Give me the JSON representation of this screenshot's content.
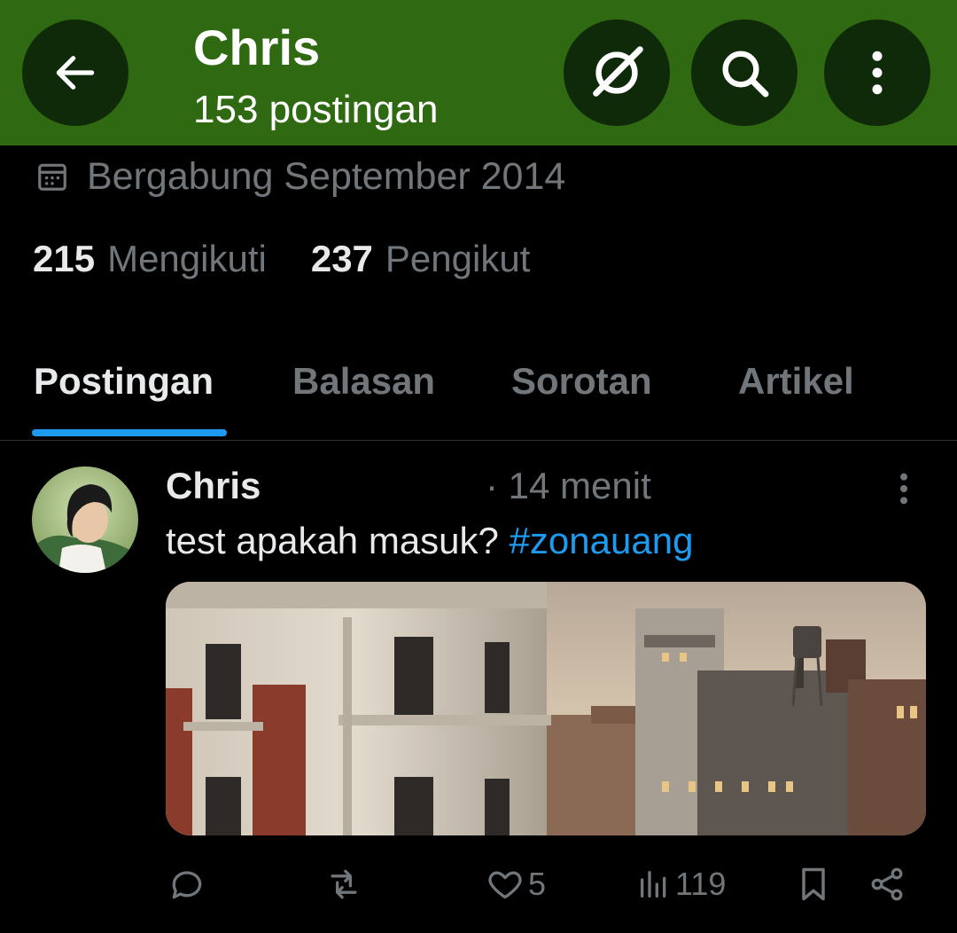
{
  "header": {
    "name": "Chris",
    "post_count": "153 postingan",
    "back_icon": "arrow-left-icon",
    "grok_icon": "grok-icon",
    "search_icon": "search-icon",
    "more_icon": "more-vertical-icon",
    "bg_color": "#2f6a12"
  },
  "profile": {
    "joined": "Bergabung September 2014",
    "following_count": "215",
    "following_label": "Mengikuti",
    "followers_count": "237",
    "followers_label": "Pengikut"
  },
  "tabs": [
    {
      "label": "Postingan",
      "active": true
    },
    {
      "label": "Balasan"
    },
    {
      "label": "Sorotan"
    },
    {
      "label": "Artikel"
    }
  ],
  "post": {
    "author": "Chris",
    "time": "· 14 menit",
    "text": "test apakah masuk?",
    "hashtag": "#zonauang",
    "likes": "5",
    "views": "119"
  },
  "colors": {
    "accent": "#1d9bf0",
    "muted": "#71767b",
    "text": "#e7e9ea"
  }
}
